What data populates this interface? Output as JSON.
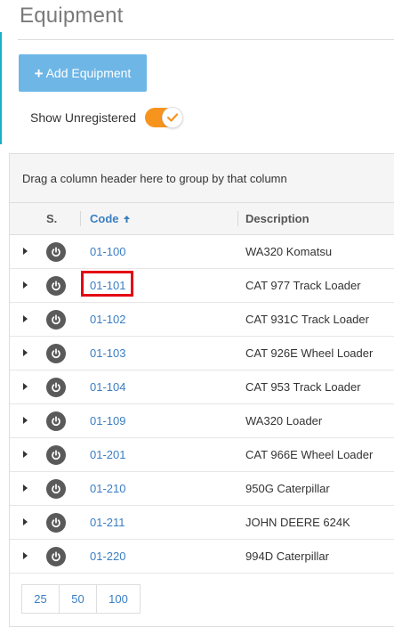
{
  "page": {
    "title": "Equipment"
  },
  "toolbar": {
    "add_label": "Add Equipment",
    "add_icon": "plus-icon",
    "toggle_label": "Show Unregistered",
    "toggle_on": true,
    "toggle_color": "#f7941e"
  },
  "grid": {
    "group_hint": "Drag a column header here to group by that column",
    "columns": {
      "status": "S.",
      "code": "Code",
      "description": "Description"
    },
    "sort": {
      "column": "code",
      "direction": "ascending"
    },
    "rows": [
      {
        "code": "01-100",
        "description": "WA320 Komatsu"
      },
      {
        "code": "01-101",
        "description": "CAT 977 Track Loader"
      },
      {
        "code": "01-102",
        "description": "CAT 931C Track Loader"
      },
      {
        "code": "01-103",
        "description": "CAT 926E Wheel Loader"
      },
      {
        "code": "01-104",
        "description": "CAT 953 Track Loader"
      },
      {
        "code": "01-109",
        "description": "WA320 Loader"
      },
      {
        "code": "01-201",
        "description": "CAT 966E Wheel Loader"
      },
      {
        "code": "01-210",
        "description": "950G Caterpillar"
      },
      {
        "code": "01-211",
        "description": "JOHN DEERE 624K"
      },
      {
        "code": "01-220",
        "description": "994D Caterpillar"
      }
    ],
    "highlighted_code": "01-101"
  },
  "pager": {
    "page_sizes": [
      "25",
      "50",
      "100"
    ]
  },
  "colors": {
    "accent": "#6eb6e6",
    "link": "#3a7ec2",
    "highlight": "#e30613"
  }
}
